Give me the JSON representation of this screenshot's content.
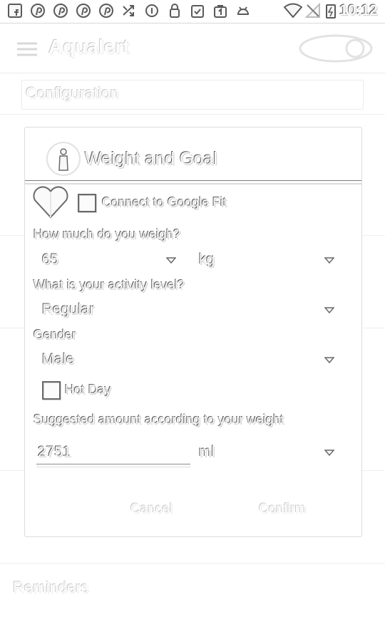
{
  "status_bar": {
    "time": "10:12",
    "icons": [
      "facebook-icon",
      "pinterest-icon",
      "pinterest-icon",
      "pinterest-icon",
      "pinterest-icon",
      "shuffle-icon",
      "info-icon",
      "lock-icon",
      "clipboard-check-icon",
      "shopping-bag-icon",
      "android-icon",
      "wifi-icon",
      "no-signal-icon",
      "battery-charging-icon"
    ]
  },
  "background_app": {
    "title": "Aqualert",
    "field_text": "Configuration",
    "bottom_text": "Reminders"
  },
  "dialog": {
    "title": "Weight and Goal",
    "google_fit": {
      "label": "Connect to Google Fit",
      "checked": false
    },
    "weight_question": "How much do you weigh?",
    "weight_value": "65",
    "weight_unit": "kg",
    "activity_question": "What is your activity level?",
    "activity_value": "Regular",
    "gender_label": "Gender",
    "gender_value": "Male",
    "hot_day": {
      "label": "Hot Day",
      "checked": false
    },
    "suggested_label": "Suggested amount according to your weight",
    "amount_value": "2751",
    "amount_unit": "ml",
    "cancel_label": "Cancel",
    "confirm_label": "Confirm"
  }
}
